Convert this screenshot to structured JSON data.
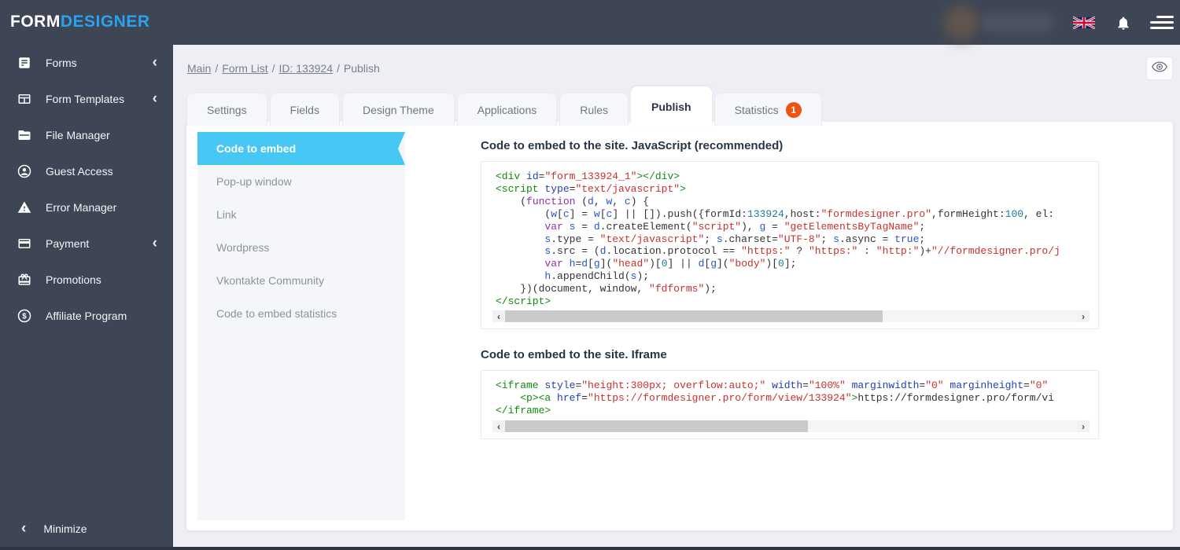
{
  "topbar": {
    "logo_part1": "FORM",
    "logo_part2": "DESIGNER",
    "language": "english-uk",
    "accent_color": "#29a3ef"
  },
  "sidebar": {
    "items": [
      {
        "label": "Forms",
        "icon": "forms-icon",
        "has_chevron": true
      },
      {
        "label": "Form Templates",
        "icon": "templates-icon",
        "has_chevron": true
      },
      {
        "label": "File Manager",
        "icon": "folder-icon",
        "has_chevron": false
      },
      {
        "label": "Guest Access",
        "icon": "person-icon",
        "has_chevron": false
      },
      {
        "label": "Error Manager",
        "icon": "warning-icon",
        "has_chevron": false
      },
      {
        "label": "Payment",
        "icon": "card-icon",
        "has_chevron": true
      },
      {
        "label": "Promotions",
        "icon": "gift-icon",
        "has_chevron": false
      },
      {
        "label": "Affiliate Program",
        "icon": "dollar-icon",
        "has_chevron": false
      }
    ],
    "minimize_label": "Minimize",
    "chevron": "‹",
    "background": "#3e4554"
  },
  "breadcrumb": {
    "separator": "/",
    "items": [
      {
        "label": "Main",
        "link": true
      },
      {
        "label": "Form List",
        "link": true
      },
      {
        "label": "ID: 133924",
        "link": true
      },
      {
        "label": "Publish",
        "link": false
      }
    ]
  },
  "tabs": [
    {
      "label": "Settings",
      "active": false
    },
    {
      "label": "Fields",
      "active": false
    },
    {
      "label": "Design Theme",
      "active": false
    },
    {
      "label": "Applications",
      "active": false
    },
    {
      "label": "Rules",
      "active": false
    },
    {
      "label": "Publish",
      "active": true
    },
    {
      "label": "Statistics",
      "active": false,
      "badge": "1"
    }
  ],
  "subnav": {
    "active_color": "#47c7f4",
    "items": [
      {
        "label": "Code to embed",
        "active": true
      },
      {
        "label": "Pop-up window",
        "active": false
      },
      {
        "label": "Link",
        "active": false
      },
      {
        "label": "Wordpress",
        "active": false
      },
      {
        "label": "Vkontakte Community",
        "active": false
      },
      {
        "label": "Code to embed statistics",
        "active": false
      }
    ]
  },
  "sections": [
    {
      "heading": "Code to embed to the site. JavaScript (recommended)",
      "scrollbar_thumb_pct": 66,
      "scroll_left_glyph": "‹",
      "scroll_right_glyph": "›",
      "code_lines": [
        [
          [
            "tag",
            "<div "
          ],
          [
            "attr",
            "id"
          ],
          [
            "pln",
            "="
          ],
          [
            "str",
            "\"form_133924_1\""
          ],
          [
            "tag",
            "></div>"
          ]
        ],
        [
          [
            "tag",
            "<script "
          ],
          [
            "attr",
            "type"
          ],
          [
            "pln",
            "="
          ],
          [
            "str",
            "\"text/javascript\""
          ],
          [
            "tag",
            ">"
          ]
        ],
        [
          [
            "pln",
            "    ("
          ],
          [
            "kwd",
            "function"
          ],
          [
            "pln",
            " ("
          ],
          [
            "var",
            "d"
          ],
          [
            "pln",
            ", "
          ],
          [
            "var",
            "w"
          ],
          [
            "pln",
            ", "
          ],
          [
            "var",
            "c"
          ],
          [
            "pln",
            ") {"
          ]
        ],
        [
          [
            "pln",
            "        ("
          ],
          [
            "var",
            "w"
          ],
          [
            "pln",
            "["
          ],
          [
            "var",
            "c"
          ],
          [
            "pln",
            "] = "
          ],
          [
            "var",
            "w"
          ],
          [
            "pln",
            "["
          ],
          [
            "var",
            "c"
          ],
          [
            "pln",
            "] || []).push({formId:"
          ],
          [
            "num",
            "133924"
          ],
          [
            "pln",
            ",host:"
          ],
          [
            "str",
            "\"formdesigner.pro\""
          ],
          [
            "pln",
            ",formHeight:"
          ],
          [
            "num",
            "100"
          ],
          [
            "pln",
            ", el:"
          ]
        ],
        [
          [
            "pln",
            "        "
          ],
          [
            "kwd",
            "var"
          ],
          [
            "pln",
            " "
          ],
          [
            "var",
            "s"
          ],
          [
            "pln",
            " = "
          ],
          [
            "var",
            "d"
          ],
          [
            "pln",
            ".createElement("
          ],
          [
            "str",
            "\"script\""
          ],
          [
            "pln",
            "), "
          ],
          [
            "var",
            "g"
          ],
          [
            "pln",
            " = "
          ],
          [
            "str",
            "\"getElementsByTagName\""
          ],
          [
            "pln",
            ";"
          ]
        ],
        [
          [
            "pln",
            "        "
          ],
          [
            "var",
            "s"
          ],
          [
            "pln",
            ".type = "
          ],
          [
            "str",
            "\"text/javascript\""
          ],
          [
            "pln",
            "; "
          ],
          [
            "var",
            "s"
          ],
          [
            "pln",
            ".charset="
          ],
          [
            "str",
            "\"UTF-8\""
          ],
          [
            "pln",
            "; "
          ],
          [
            "var",
            "s"
          ],
          [
            "pln",
            ".async = "
          ],
          [
            "var",
            "true"
          ],
          [
            "pln",
            ";"
          ]
        ],
        [
          [
            "pln",
            "        "
          ],
          [
            "var",
            "s"
          ],
          [
            "pln",
            ".src = ("
          ],
          [
            "var",
            "d"
          ],
          [
            "pln",
            ".location.protocol == "
          ],
          [
            "str",
            "\"https:\""
          ],
          [
            "pln",
            " ? "
          ],
          [
            "str",
            "\"https:\""
          ],
          [
            "pln",
            " : "
          ],
          [
            "str",
            "\"http:\""
          ],
          [
            "pln",
            ")+"
          ],
          [
            "str",
            "\"//formdesigner.pro/j"
          ]
        ],
        [
          [
            "pln",
            "        "
          ],
          [
            "kwd",
            "var"
          ],
          [
            "pln",
            " "
          ],
          [
            "var",
            "h"
          ],
          [
            "pln",
            "="
          ],
          [
            "var",
            "d"
          ],
          [
            "pln",
            "["
          ],
          [
            "var",
            "g"
          ],
          [
            "pln",
            "]("
          ],
          [
            "str",
            "\"head\""
          ],
          [
            "pln",
            ")["
          ],
          [
            "num",
            "0"
          ],
          [
            "pln",
            "] || "
          ],
          [
            "var",
            "d"
          ],
          [
            "pln",
            "["
          ],
          [
            "var",
            "g"
          ],
          [
            "pln",
            "]("
          ],
          [
            "str",
            "\"body\""
          ],
          [
            "pln",
            ")["
          ],
          [
            "num",
            "0"
          ],
          [
            "pln",
            "];"
          ]
        ],
        [
          [
            "pln",
            "        "
          ],
          [
            "var",
            "h"
          ],
          [
            "pln",
            ".appendChild("
          ],
          [
            "var",
            "s"
          ],
          [
            "pln",
            ");"
          ]
        ],
        [
          [
            "pln",
            "    })(document, window, "
          ],
          [
            "str",
            "\"fdforms\""
          ],
          [
            "pln",
            ");"
          ]
        ],
        [
          [
            "tag",
            "</script>"
          ]
        ]
      ]
    },
    {
      "heading": "Code to embed to the site. Iframe",
      "scrollbar_thumb_pct": 53,
      "scroll_left_glyph": "‹",
      "scroll_right_glyph": "›",
      "code_lines": [
        [
          [
            "tag",
            "<iframe "
          ],
          [
            "attr",
            "style"
          ],
          [
            "pln",
            "="
          ],
          [
            "str",
            "\"height:300px; overflow:auto;\""
          ],
          [
            "pln",
            " "
          ],
          [
            "attr",
            "width"
          ],
          [
            "pln",
            "="
          ],
          [
            "str",
            "\"100%\""
          ],
          [
            "pln",
            " "
          ],
          [
            "attr",
            "marginwidth"
          ],
          [
            "pln",
            "="
          ],
          [
            "str",
            "\"0\""
          ],
          [
            "pln",
            " "
          ],
          [
            "attr",
            "marginheight"
          ],
          [
            "pln",
            "="
          ],
          [
            "str",
            "\"0\""
          ]
        ],
        [
          [
            "tag",
            "    <p><a "
          ],
          [
            "attr",
            "href"
          ],
          [
            "pln",
            "="
          ],
          [
            "str",
            "\"https://formdesigner.pro/form/view/133924\""
          ],
          [
            "tag",
            ">"
          ],
          [
            "pln",
            "https://formdesigner.pro/form/vi"
          ]
        ],
        [
          [
            "tag",
            "</iframe>"
          ]
        ]
      ]
    }
  ]
}
